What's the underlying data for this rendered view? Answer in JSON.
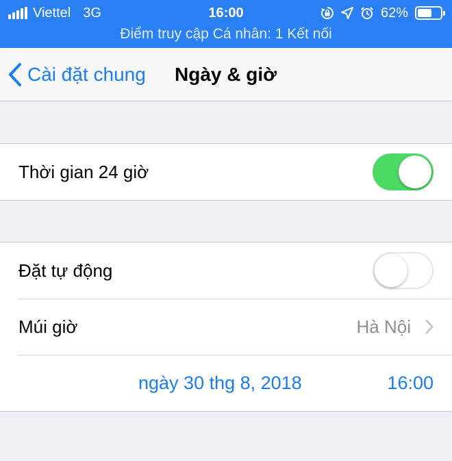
{
  "status_bar": {
    "carrier": "Viettel",
    "network": "3G",
    "time": "16:00",
    "battery_percent": "62%",
    "battery_level": 0.62,
    "icons": [
      "signal-icon",
      "rotation-lock-icon",
      "location-icon",
      "alarm-icon",
      "battery-icon"
    ],
    "hotspot_text": "Điểm truy cập Cá nhân: 1 Kết nối"
  },
  "nav": {
    "back_label": "Cài đặt chung",
    "title": "Ngày & giờ"
  },
  "settings": {
    "time_24h": {
      "label": "Thời gian 24 giờ",
      "enabled": true
    },
    "auto_set": {
      "label": "Đặt tự động",
      "enabled": false
    },
    "timezone": {
      "label": "Múi giờ",
      "value": "Hà Nội"
    },
    "date": "ngày 30 thg 8, 2018",
    "time": "16:00"
  },
  "colors": {
    "accent": "#1a7cf5",
    "status_bar": "#2a7ff3",
    "switch_on": "#4cd964",
    "background": "#efeff4"
  }
}
